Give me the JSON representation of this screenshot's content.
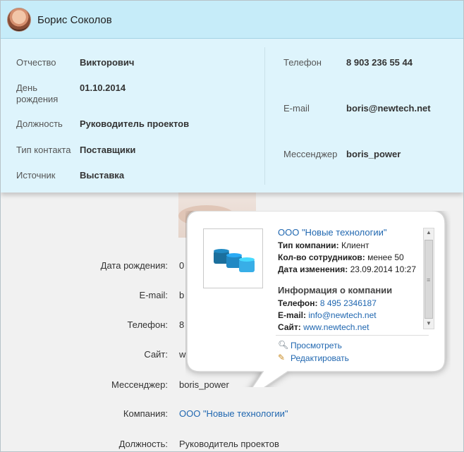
{
  "contact": {
    "name": "Борис Соколов",
    "left_fields": [
      {
        "label": "Отчество",
        "value": "Викторович"
      },
      {
        "label": "День рождения",
        "value": "01.10.2014"
      },
      {
        "label": "Должность",
        "value": "Руководитель проектов"
      },
      {
        "label": "Тип контакта",
        "value": "Поставщики"
      },
      {
        "label": "Источник",
        "value": "Выставка"
      }
    ],
    "right_fields": [
      {
        "label": "Телефон",
        "value": "8 903 236 55 44"
      },
      {
        "label": "E-mail",
        "value": "boris@newtech.net"
      },
      {
        "label": "Мессенджер",
        "value": "boris_power"
      }
    ]
  },
  "details": {
    "birth_label": "Дата рождения:",
    "email_label": "E-mail:",
    "phone_label": "Телефон:",
    "site_label": "Сайт:",
    "messenger_label": "Мессенджер:",
    "messenger_value": "boris_power",
    "company_label": "Компания:",
    "company_value": "ООО \"Новые технологии\"",
    "position_label": "Должность:",
    "position_value": "Руководитель проектов",
    "birth_partial": "0",
    "email_partial": "b",
    "phone_partial": "8",
    "site_partial": "w"
  },
  "company_popup": {
    "name": "ООО \"Новые технологии\"",
    "type_label": "Тип компании:",
    "type_value": "Клиент",
    "employees_label": "Кол-во сотрудников:",
    "employees_value": "менее 50",
    "changed_label": "Дата изменения:",
    "changed_value": "23.09.2014 10:27",
    "info_heading": "Информация о компании",
    "phone_label": "Телефон:",
    "phone_value": "8 495 2346187",
    "email_label": "E-mail:",
    "email_value": "info@newtech.net",
    "site_label": "Сайт:",
    "site_value": "www.newtech.net",
    "view_label": "Просмотреть",
    "edit_label": "Редактировать"
  }
}
